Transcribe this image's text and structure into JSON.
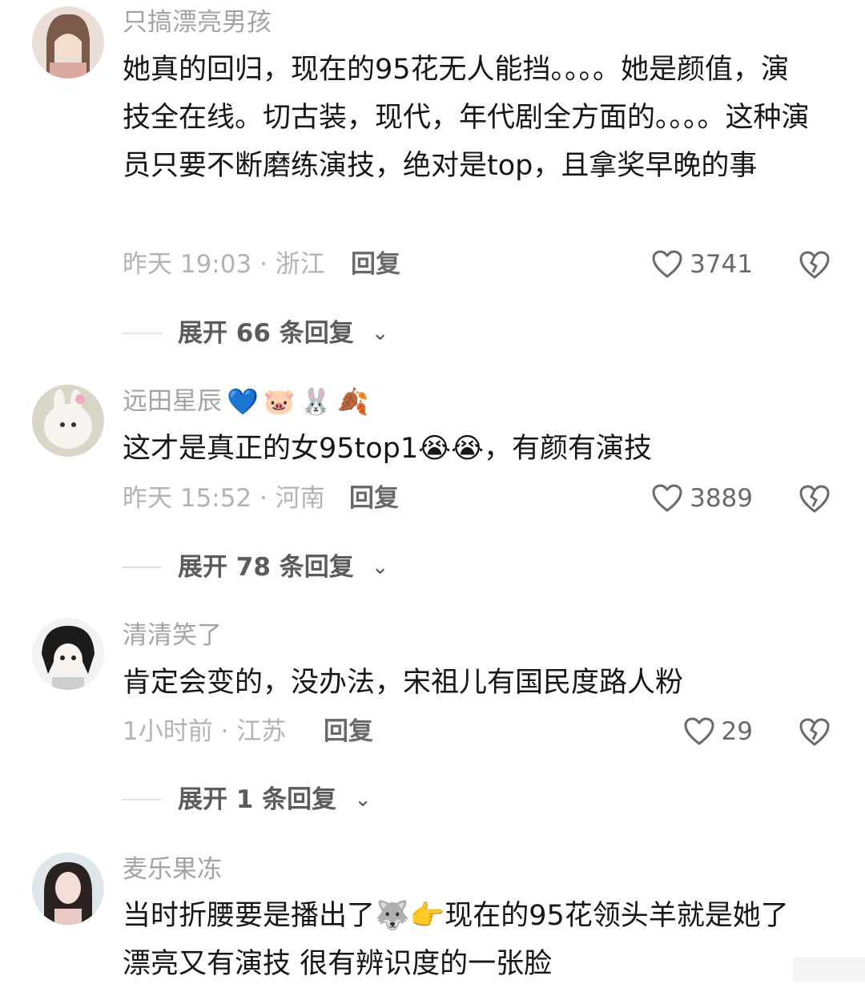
{
  "comments": [
    {
      "username": "只搞漂亮男孩",
      "emojis": [],
      "text": "她真的回归，现在的95花无人能挡。。。。她是颜值，演技全在线。切古装，现代，年代剧全方面的。。。。这种演员只要不断磨练演技，绝对是top，且拿奖早晚的事",
      "time_location": "昨天 19:03 · 浙江",
      "reply_label": "回复",
      "likes": "3741",
      "expand_label": "展开 66 条回复"
    },
    {
      "username": "远田星辰",
      "emojis": [
        "💙",
        "🐷",
        "🐰",
        "🍂"
      ],
      "text": "这才是真正的女95top1",
      "text_emojis": [
        "😭",
        "😭"
      ],
      "text_tail": "，有颜有演技",
      "time_location": "昨天 15:52 · 河南",
      "reply_label": "回复",
      "likes": "3889",
      "expand_label": "展开 78 条回复"
    },
    {
      "username": "清清笑了",
      "emojis": [],
      "text": "肯定会变的，没办法，宋祖儿有国民度路人粉",
      "time_location": "1小时前 · 江苏",
      "reply_label": "回复",
      "likes": "29",
      "expand_label": "展开 1 条回复"
    },
    {
      "username": "麦乐果冻",
      "emojis": [],
      "text": "当时折腰要是播出了",
      "text_emojis": [
        "🐺",
        "👉"
      ],
      "text_tail": "现在的95花领头羊就是她了  漂亮又有演技  很有辨识度的一张脸"
    }
  ],
  "icons": {
    "like": "heart-outline-icon",
    "dislike": "broken-heart-icon",
    "expand": "chevron-down-icon"
  },
  "colors": {
    "username": "#a3a3a3",
    "text": "#161616",
    "meta": "#b3b3b3",
    "action": "#6a6a6a"
  }
}
